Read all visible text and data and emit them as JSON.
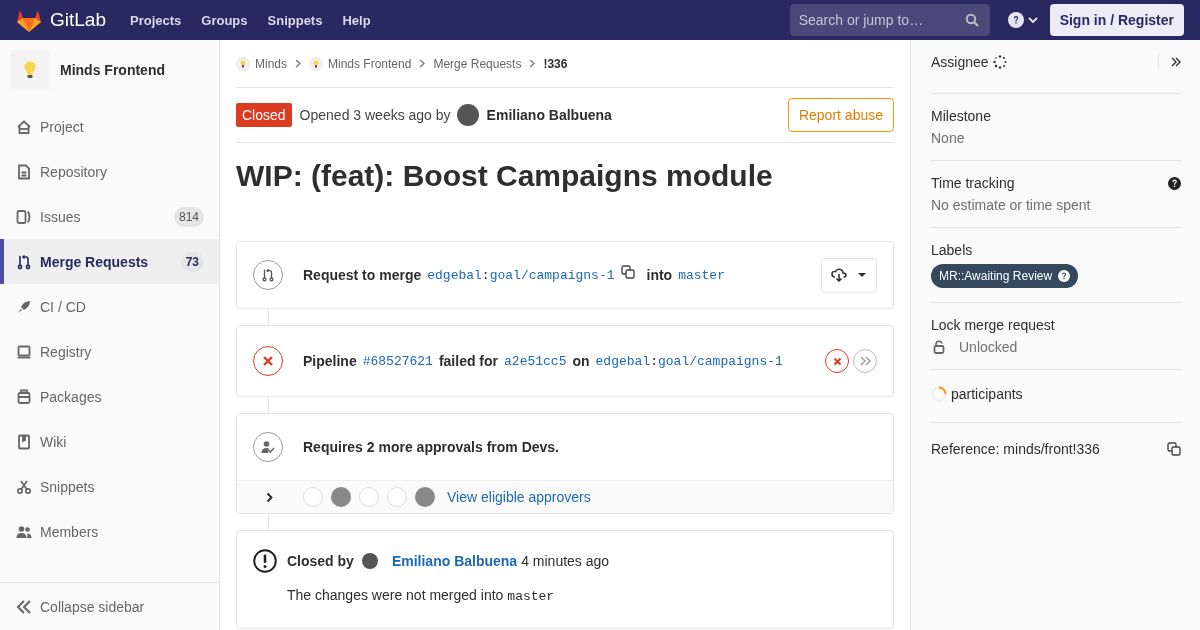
{
  "topbar": {
    "logo": "GitLab",
    "nav": [
      "Projects",
      "Groups",
      "Snippets",
      "Help"
    ],
    "search": {
      "placeholder": "Search or jump to…"
    },
    "sign_in": "Sign in / Register"
  },
  "sidebar": {
    "project": "Minds Frontend",
    "items": [
      {
        "label": "Project",
        "selected": false
      },
      {
        "label": "Repository",
        "selected": false
      },
      {
        "label": "Issues",
        "count": "814",
        "selected": false
      },
      {
        "label": "Merge Requests",
        "count": "73",
        "selected": true
      },
      {
        "label": "CI / CD",
        "selected": false
      },
      {
        "label": "Registry",
        "selected": false
      },
      {
        "label": "Packages",
        "selected": false
      },
      {
        "label": "Wiki",
        "selected": false
      },
      {
        "label": "Snippets",
        "selected": false
      },
      {
        "label": "Members",
        "selected": false
      }
    ],
    "collapse": "Collapse sidebar"
  },
  "breadcrumbs": [
    {
      "label": "Minds",
      "kind": "avatar"
    },
    {
      "label": "Minds Frontend",
      "kind": "avatar"
    },
    {
      "label": "Merge Requests",
      "kind": "plain"
    },
    {
      "label": "!336",
      "kind": "current"
    }
  ],
  "mr": {
    "state": "Closed",
    "opened": "Opened 3 weeks ago by",
    "author": "Emiliano Balbuena",
    "report": "Report abuse",
    "title": "WIP: (feat): Boost Campaigns module"
  },
  "merge": {
    "prefix": "Request to merge",
    "source": {
      "namespace": "edgebal",
      "separator": ":",
      "branch": "goal/campaigns-1"
    },
    "into": "into",
    "target": "master"
  },
  "pipeline": {
    "label": "Pipeline",
    "id": "#68527621",
    "failed_for": "failed for",
    "sha": "a2e51cc5",
    "on": "on",
    "source": {
      "namespace": "edgebal",
      "separator": ":",
      "branch": "goal/campaigns-1"
    }
  },
  "approvals": {
    "text": "Requires 2 more approvals from Devs.",
    "approvers": [
      {
        "kind": "empty"
      },
      {
        "kind": "photo"
      },
      {
        "kind": "empty"
      },
      {
        "kind": "empty"
      },
      {
        "kind": "photo"
      }
    ],
    "link": "View eligible approvers"
  },
  "closed": {
    "label": "Closed by",
    "user": "Emiliano Balbuena",
    "time": "4 minutes ago",
    "message": "The changes were not merged into",
    "branch": "master"
  },
  "right": {
    "assignee": "Assignee",
    "milestone": {
      "label": "Milestone",
      "value": "None"
    },
    "time_tracking": {
      "label": "Time tracking",
      "value": "No estimate or time spent"
    },
    "labels": {
      "label": "Labels",
      "items": [
        {
          "text": "MR::Awaiting Review",
          "color": "#34495e"
        }
      ]
    },
    "lock": {
      "label": "Lock merge request",
      "value": "Unlocked"
    },
    "participants": "participants",
    "reference": "Reference: minds/front!336"
  }
}
